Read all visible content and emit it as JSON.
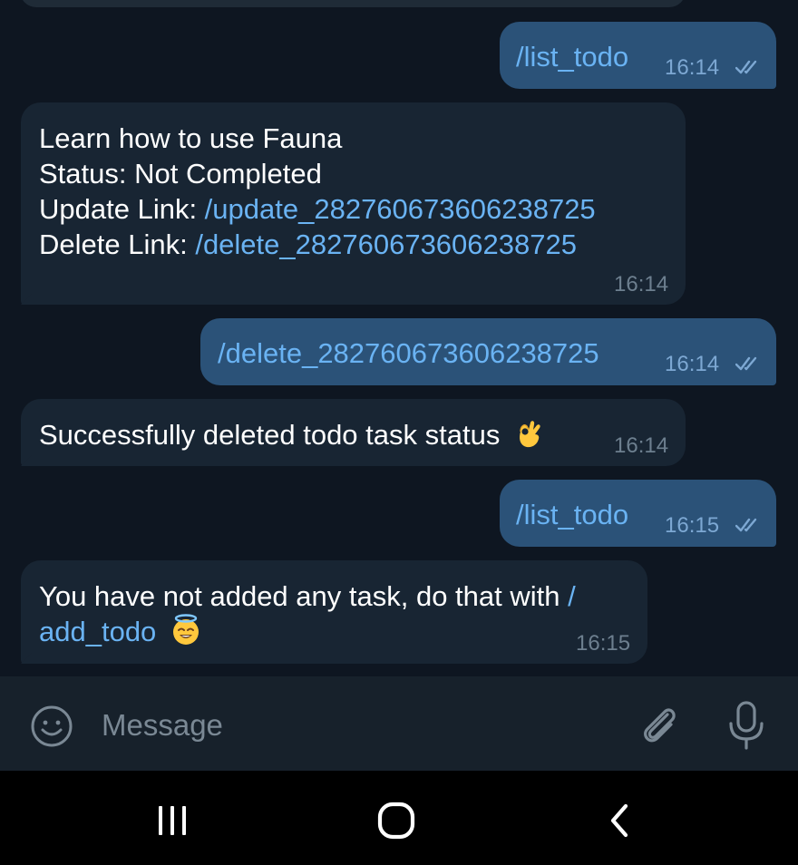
{
  "colors": {
    "chat_background": "#0e1621",
    "outgoing_bubble": "#2b5278",
    "incoming_bubble": "#182533",
    "link": "#6ab3f3",
    "input_bar": "#17212b",
    "nav_bar": "#000000"
  },
  "messages": [
    {
      "direction": "outgoing",
      "text": "/list_todo",
      "time": "16:14",
      "status_icon": "double-check-icon"
    },
    {
      "direction": "incoming",
      "line1": "Learn how to use Fauna",
      "line2": "Status: Not Completed",
      "line3_label": "Update Link: ",
      "line3_link": "/update_282760673606238725",
      "line4_label": "Delete Link: ",
      "line4_link": "/delete_282760673606238725",
      "time": "16:14"
    },
    {
      "direction": "outgoing",
      "text": "/delete_282760673606238725",
      "time": "16:14",
      "status_icon": "double-check-icon"
    },
    {
      "direction": "incoming",
      "text": "Successfully deleted todo task status",
      "emoji": "ok-hand-emoji",
      "time": "16:14"
    },
    {
      "direction": "outgoing",
      "text": "/list_todo",
      "time": "16:15",
      "status_icon": "double-check-icon"
    },
    {
      "direction": "incoming",
      "line1_text": "You have not added any task, do that with ",
      "line1_link": "/",
      "line2_link": "add_todo",
      "emoji": "smiling-face-with-halo-emoji",
      "time": "16:15"
    }
  ],
  "input": {
    "placeholder": "Message",
    "emoji_icon": "smiley-icon",
    "attach_icon": "paperclip-icon",
    "mic_icon": "microphone-icon"
  },
  "navigation": {
    "recent_icon": "recent-apps-icon",
    "home_icon": "home-icon",
    "back_icon": "back-icon"
  }
}
